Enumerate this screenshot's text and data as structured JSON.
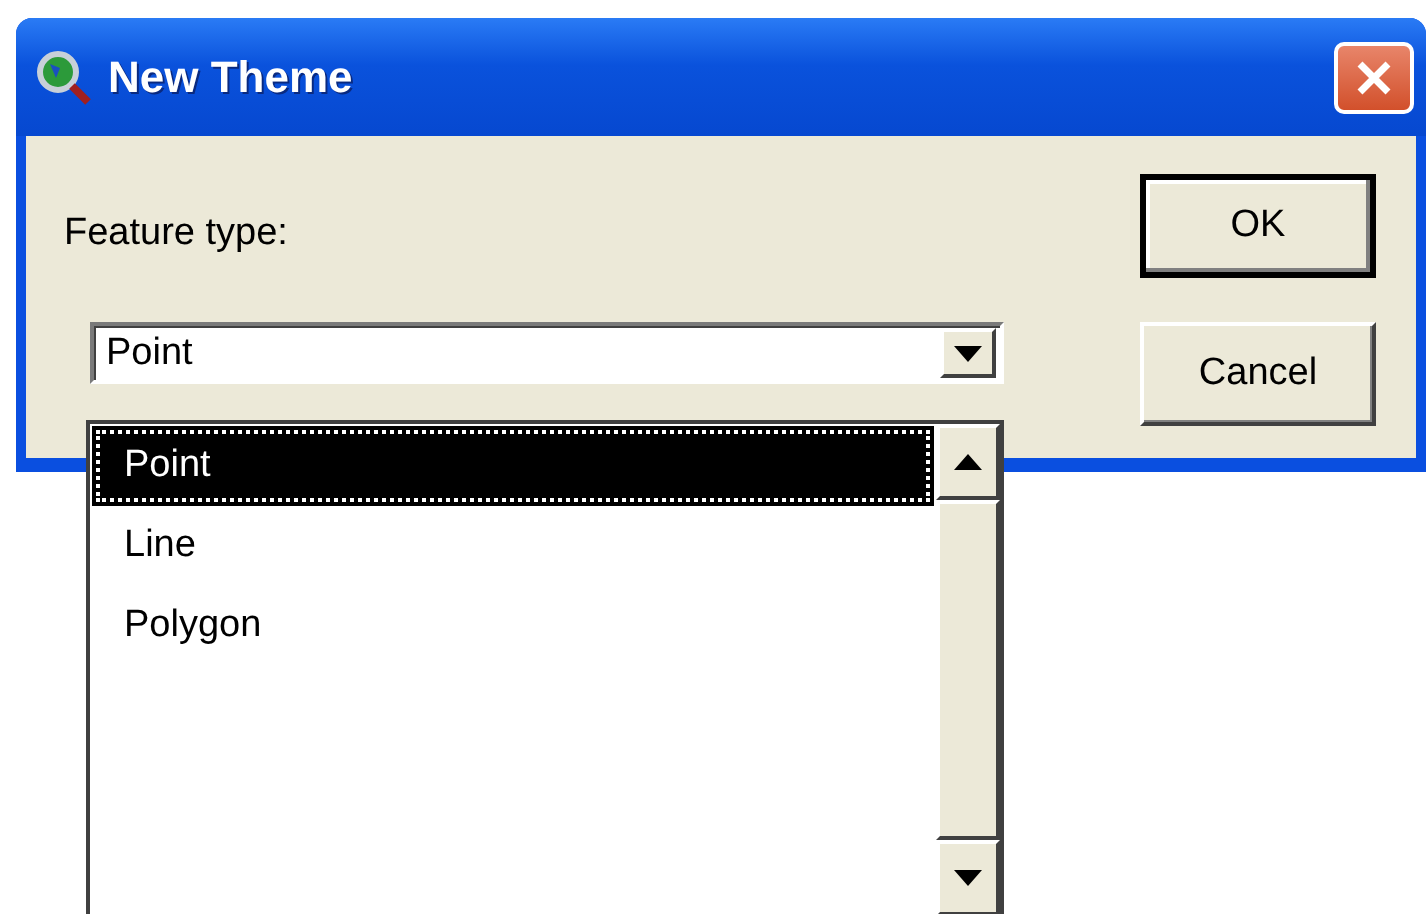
{
  "window": {
    "title": "New Theme"
  },
  "field_label": "Feature type:",
  "combo": {
    "value": "Point",
    "expanded": true
  },
  "list": {
    "items": [
      {
        "label": "Point",
        "selected": true
      },
      {
        "label": "Line",
        "selected": false
      },
      {
        "label": "Polygon",
        "selected": false
      }
    ]
  },
  "buttons": [
    {
      "label": "OK",
      "default": true
    },
    {
      "label": "Cancel",
      "default": false
    }
  ]
}
